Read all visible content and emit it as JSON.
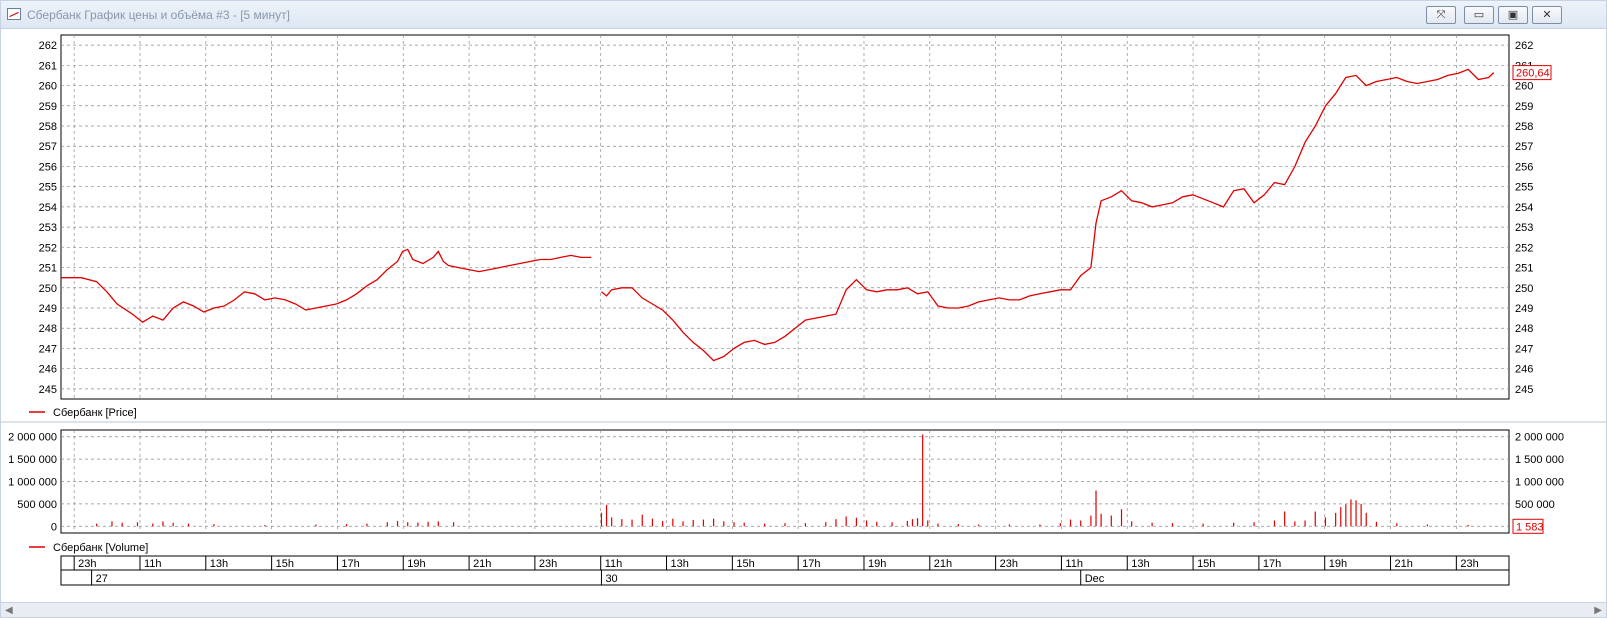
{
  "window": {
    "title": "Сбербанк График цены и объёма #3 - [5 минут]",
    "buttons": {
      "pin": "⤧",
      "minimize": "▭",
      "maximize": "▣",
      "close": "✕"
    }
  },
  "colors": {
    "series": "#e00000",
    "grid": "#8c8c8c",
    "text": "#000000"
  },
  "chart_data": [
    {
      "type": "line",
      "name": "price",
      "legend": "Сбербанк [Price]",
      "ylim": [
        244.5,
        262.5
      ],
      "yticks": [
        245,
        246,
        247,
        248,
        249,
        250,
        251,
        252,
        253,
        254,
        255,
        256,
        257,
        258,
        259,
        260,
        261,
        262
      ],
      "last_value_label": "260,64",
      "segments": [
        [
          [
            0,
            250.5
          ],
          [
            4,
            250.5
          ],
          [
            7,
            250.3
          ],
          [
            9,
            249.8
          ],
          [
            11,
            249.2
          ],
          [
            14,
            248.7
          ],
          [
            16,
            248.3
          ],
          [
            18,
            248.6
          ],
          [
            20,
            248.4
          ],
          [
            22,
            249.0
          ],
          [
            24,
            249.3
          ],
          [
            26,
            249.1
          ],
          [
            28,
            248.8
          ],
          [
            30,
            249.0
          ],
          [
            32,
            249.1
          ],
          [
            34,
            249.4
          ],
          [
            36,
            249.8
          ],
          [
            38,
            249.7
          ],
          [
            40,
            249.4
          ],
          [
            42,
            249.5
          ],
          [
            44,
            249.4
          ],
          [
            46,
            249.2
          ],
          [
            48,
            248.9
          ],
          [
            50,
            249.0
          ],
          [
            52,
            249.1
          ],
          [
            54,
            249.2
          ],
          [
            56,
            249.4
          ],
          [
            58,
            249.7
          ],
          [
            60,
            250.1
          ],
          [
            62,
            250.4
          ],
          [
            64,
            250.9
          ],
          [
            66,
            251.3
          ],
          [
            67,
            251.8
          ],
          [
            68,
            251.9
          ],
          [
            69,
            251.4
          ],
          [
            70,
            251.3
          ],
          [
            71,
            251.2
          ],
          [
            73,
            251.5
          ],
          [
            74,
            251.8
          ],
          [
            75,
            251.3
          ],
          [
            76,
            251.1
          ],
          [
            78,
            251.0
          ],
          [
            80,
            250.9
          ],
          [
            82,
            250.8
          ],
          [
            84,
            250.9
          ],
          [
            86,
            251.0
          ],
          [
            88,
            251.1
          ],
          [
            90,
            251.2
          ],
          [
            92,
            251.3
          ],
          [
            94,
            251.4
          ],
          [
            96,
            251.4
          ],
          [
            98,
            251.5
          ],
          [
            100,
            251.6
          ],
          [
            102,
            251.5
          ],
          [
            104,
            251.5
          ]
        ],
        [
          [
            106,
            249.8
          ],
          [
            107,
            249.6
          ],
          [
            108,
            249.9
          ],
          [
            110,
            250.0
          ],
          [
            112,
            250.0
          ],
          [
            114,
            249.5
          ],
          [
            116,
            249.2
          ],
          [
            118,
            248.9
          ],
          [
            120,
            248.4
          ],
          [
            122,
            247.8
          ],
          [
            124,
            247.3
          ],
          [
            126,
            246.9
          ],
          [
            128,
            246.4
          ],
          [
            130,
            246.6
          ],
          [
            132,
            247.0
          ],
          [
            134,
            247.3
          ],
          [
            136,
            247.4
          ],
          [
            138,
            247.2
          ],
          [
            140,
            247.3
          ],
          [
            142,
            247.6
          ],
          [
            144,
            248.0
          ],
          [
            146,
            248.4
          ],
          [
            148,
            248.5
          ],
          [
            150,
            248.6
          ],
          [
            152,
            248.7
          ],
          [
            154,
            249.9
          ],
          [
            156,
            250.4
          ],
          [
            158,
            249.9
          ],
          [
            160,
            249.8
          ],
          [
            162,
            249.9
          ],
          [
            164,
            249.9
          ],
          [
            166,
            250.0
          ],
          [
            168,
            249.7
          ],
          [
            170,
            249.8
          ],
          [
            172,
            249.1
          ],
          [
            174,
            249.0
          ],
          [
            176,
            249.0
          ],
          [
            178,
            249.1
          ],
          [
            180,
            249.3
          ],
          [
            182,
            249.4
          ],
          [
            184,
            249.5
          ],
          [
            186,
            249.4
          ],
          [
            188,
            249.4
          ],
          [
            190,
            249.6
          ],
          [
            192,
            249.7
          ],
          [
            194,
            249.8
          ],
          [
            196,
            249.9
          ],
          [
            198,
            249.9
          ],
          [
            200,
            250.6
          ],
          [
            202,
            251.0
          ],
          [
            203,
            253.2
          ],
          [
            204,
            254.3
          ],
          [
            206,
            254.5
          ],
          [
            208,
            254.8
          ],
          [
            210,
            254.3
          ],
          [
            212,
            254.2
          ],
          [
            214,
            254.0
          ],
          [
            216,
            254.1
          ],
          [
            218,
            254.2
          ],
          [
            220,
            254.5
          ],
          [
            222,
            254.6
          ],
          [
            224,
            254.4
          ],
          [
            226,
            254.2
          ],
          [
            228,
            254.0
          ],
          [
            230,
            254.8
          ],
          [
            232,
            254.9
          ],
          [
            234,
            254.2
          ],
          [
            236,
            254.6
          ],
          [
            238,
            255.2
          ],
          [
            240,
            255.1
          ],
          [
            242,
            256.0
          ],
          [
            244,
            257.2
          ],
          [
            246,
            258.0
          ],
          [
            248,
            259.0
          ],
          [
            250,
            259.6
          ],
          [
            252,
            260.4
          ],
          [
            254,
            260.5
          ],
          [
            256,
            260.0
          ],
          [
            258,
            260.2
          ],
          [
            260,
            260.3
          ],
          [
            262,
            260.4
          ],
          [
            264,
            260.2
          ],
          [
            266,
            260.1
          ],
          [
            268,
            260.2
          ],
          [
            270,
            260.3
          ],
          [
            272,
            260.5
          ],
          [
            274,
            260.6
          ],
          [
            276,
            260.8
          ],
          [
            278,
            260.3
          ],
          [
            280,
            260.4
          ],
          [
            281,
            260.64
          ]
        ]
      ]
    },
    {
      "type": "bar",
      "name": "volume",
      "legend": "Сбербанк [Volume]",
      "ylim": [
        -150000,
        2150000
      ],
      "ytick_labels": [
        "2 000 000",
        "1 500 000",
        "1 000 000",
        "500 000",
        "0"
      ],
      "ytick_values": [
        2000000,
        1500000,
        1000000,
        500000,
        0
      ],
      "last_value_label": "1 583",
      "bars": [
        [
          7,
          60000
        ],
        [
          10,
          110000
        ],
        [
          12,
          80000
        ],
        [
          15,
          90000
        ],
        [
          18,
          60000
        ],
        [
          20,
          110000
        ],
        [
          22,
          80000
        ],
        [
          25,
          60000
        ],
        [
          30,
          50000
        ],
        [
          40,
          30000
        ],
        [
          50,
          40000
        ],
        [
          56,
          50000
        ],
        [
          60,
          60000
        ],
        [
          64,
          90000
        ],
        [
          66,
          120000
        ],
        [
          68,
          90000
        ],
        [
          70,
          80000
        ],
        [
          72,
          100000
        ],
        [
          74,
          110000
        ],
        [
          77,
          90000
        ],
        [
          106,
          300000
        ],
        [
          107,
          480000
        ],
        [
          108,
          200000
        ],
        [
          110,
          160000
        ],
        [
          112,
          150000
        ],
        [
          114,
          260000
        ],
        [
          116,
          170000
        ],
        [
          118,
          120000
        ],
        [
          120,
          170000
        ],
        [
          122,
          110000
        ],
        [
          124,
          140000
        ],
        [
          126,
          150000
        ],
        [
          128,
          170000
        ],
        [
          130,
          110000
        ],
        [
          132,
          90000
        ],
        [
          134,
          80000
        ],
        [
          138,
          60000
        ],
        [
          142,
          70000
        ],
        [
          146,
          70000
        ],
        [
          150,
          90000
        ],
        [
          152,
          160000
        ],
        [
          154,
          220000
        ],
        [
          156,
          190000
        ],
        [
          158,
          130000
        ],
        [
          160,
          100000
        ],
        [
          163,
          90000
        ],
        [
          166,
          120000
        ],
        [
          167,
          160000
        ],
        [
          168,
          180000
        ],
        [
          169,
          2050000
        ],
        [
          170,
          130000
        ],
        [
          172,
          60000
        ],
        [
          176,
          50000
        ],
        [
          180,
          40000
        ],
        [
          186,
          40000
        ],
        [
          192,
          40000
        ],
        [
          196,
          70000
        ],
        [
          198,
          150000
        ],
        [
          200,
          130000
        ],
        [
          202,
          240000
        ],
        [
          203,
          800000
        ],
        [
          204,
          280000
        ],
        [
          206,
          240000
        ],
        [
          208,
          380000
        ],
        [
          210,
          110000
        ],
        [
          214,
          80000
        ],
        [
          218,
          70000
        ],
        [
          224,
          60000
        ],
        [
          230,
          80000
        ],
        [
          234,
          90000
        ],
        [
          238,
          130000
        ],
        [
          240,
          330000
        ],
        [
          242,
          110000
        ],
        [
          244,
          130000
        ],
        [
          246,
          330000
        ],
        [
          248,
          200000
        ],
        [
          250,
          300000
        ],
        [
          251,
          430000
        ],
        [
          252,
          490000
        ],
        [
          253,
          600000
        ],
        [
          254,
          580000
        ],
        [
          255,
          500000
        ],
        [
          256,
          300000
        ],
        [
          258,
          100000
        ],
        [
          262,
          70000
        ],
        [
          268,
          40000
        ],
        [
          276,
          30000
        ]
      ]
    }
  ],
  "time_axis": {
    "hour_labels": [
      "23h",
      "11h",
      "13h",
      "15h",
      "17h",
      "19h",
      "21h",
      "23h",
      "11h",
      "13h",
      "15h",
      "17h",
      "19h",
      "21h",
      "23h",
      "11h",
      "13h",
      "15h",
      "17h",
      "19h",
      "21h",
      "23h"
    ],
    "day_labels": [
      {
        "text": "27",
        "at": 6
      },
      {
        "text": "30",
        "at": 106
      },
      {
        "text": "Dec",
        "at": 200
      }
    ]
  },
  "legends": {
    "price": "Сбербанк [Price]",
    "volume": "Сбербанк [Volume]"
  }
}
